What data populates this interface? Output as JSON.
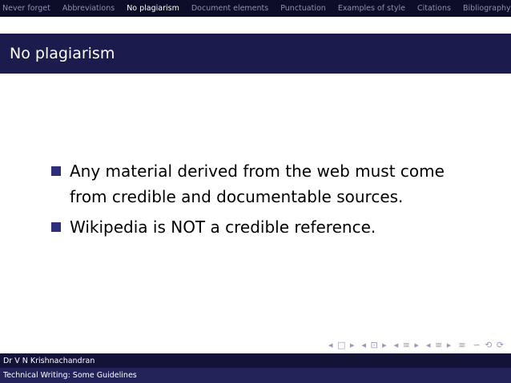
{
  "nav": {
    "sections": [
      "Never forget",
      "Abbreviations",
      "No plagiarism",
      "Document elements",
      "Punctuation",
      "Examples of style",
      "Citations",
      "Bibliography"
    ],
    "active": "No plagiarism"
  },
  "slide": {
    "title": "No plagiarism",
    "bullets": [
      "Any material derived from the web must come from credible and documentable sources.",
      "Wikipedia is NOT a credible reference."
    ]
  },
  "footer": {
    "author": "Dr V N Krishnachandran",
    "title": "Technical Writing: Some Guidelines"
  },
  "navsymbols": [
    "◂ □ ▸",
    "◂ ⊡ ▸",
    "◂ ≡ ▸",
    "◂ ≡ ▸",
    "≡",
    "∽ ⟲ ⟳"
  ],
  "colors": {
    "nav_bg": "#0d0d2a",
    "title_bg": "#1b1b4d",
    "bullet": "#2e2e7a",
    "footer_author_bg": "#131337",
    "footer_title_bg": "#23235a"
  }
}
